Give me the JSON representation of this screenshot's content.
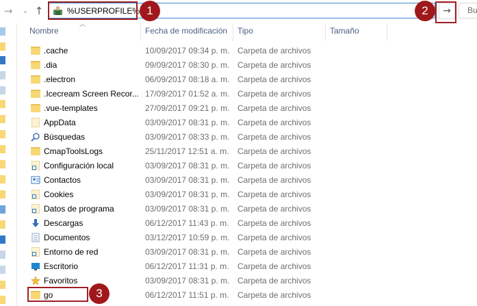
{
  "nav": {
    "back_glyph": "→",
    "forward_glyph": "⌄",
    "up_glyph": "↑"
  },
  "address": {
    "value": "%USERPROFILE%",
    "icon": "user-folder-icon",
    "go_glyph": "→",
    "search_partial": "Bu"
  },
  "annotations": [
    "1",
    "2",
    "3"
  ],
  "columns": {
    "name": "Nombre",
    "date": "Fecha de modificación",
    "type": "Tipo",
    "size": "Tamaño"
  },
  "files": [
    {
      "name": ".cache",
      "date": "10/09/2017 09:34 p. m.",
      "type": "Carpeta de archivos",
      "icon": "folder-icon"
    },
    {
      "name": ".dia",
      "date": "09/09/2017 08:30 p. m.",
      "type": "Carpeta de archivos",
      "icon": "folder-icon"
    },
    {
      "name": ".electron",
      "date": "06/09/2017 08:18 a. m.",
      "type": "Carpeta de archivos",
      "icon": "folder-icon"
    },
    {
      "name": ".Icecream Screen Recor...",
      "date": "17/09/2017 01:52 a. m.",
      "type": "Carpeta de archivos",
      "icon": "folder-icon"
    },
    {
      "name": ".vue-templates",
      "date": "27/09/2017 09:21 p. m.",
      "type": "Carpeta de archivos",
      "icon": "folder-icon"
    },
    {
      "name": "AppData",
      "date": "03/09/2017 08:31 p. m.",
      "type": "Carpeta de archivos",
      "icon": "hidden-folder-icon"
    },
    {
      "name": "Búsquedas",
      "date": "03/09/2017 08:33 p. m.",
      "type": "Carpeta de archivos",
      "icon": "search-folder-icon"
    },
    {
      "name": "CmapToolsLogs",
      "date": "25/11/2017 12:51 a. m.",
      "type": "Carpeta de archivos",
      "icon": "folder-icon"
    },
    {
      "name": "Configuración local",
      "date": "03/09/2017 08:31 p. m.",
      "type": "Carpeta de archivos",
      "icon": "shortcut-folder-icon"
    },
    {
      "name": "Contactos",
      "date": "03/09/2017 08:31 p. m.",
      "type": "Carpeta de archivos",
      "icon": "contacts-icon"
    },
    {
      "name": "Cookies",
      "date": "03/09/2017 08:31 p. m.",
      "type": "Carpeta de archivos",
      "icon": "shortcut-folder-icon"
    },
    {
      "name": "Datos de programa",
      "date": "03/09/2017 08:31 p. m.",
      "type": "Carpeta de archivos",
      "icon": "shortcut-folder-icon"
    },
    {
      "name": "Descargas",
      "date": "06/12/2017 11:43 p. m.",
      "type": "Carpeta de archivos",
      "icon": "downloads-icon"
    },
    {
      "name": "Documentos",
      "date": "03/12/2017 10:59 p. m.",
      "type": "Carpeta de archivos",
      "icon": "documents-icon"
    },
    {
      "name": "Entorno de red",
      "date": "03/09/2017 08:31 p. m.",
      "type": "Carpeta de archivos",
      "icon": "shortcut-folder-icon"
    },
    {
      "name": "Escritorio",
      "date": "06/12/2017 11:31 p. m.",
      "type": "Carpeta de archivos",
      "icon": "desktop-icon"
    },
    {
      "name": "Favoritos",
      "date": "03/09/2017 08:31 p. m.",
      "type": "Carpeta de archivos",
      "icon": "favorites-icon"
    },
    {
      "name": "go",
      "date": "06/12/2017 11:51 p. m.",
      "type": "Carpeta de archivos",
      "icon": "folder-icon"
    }
  ]
}
